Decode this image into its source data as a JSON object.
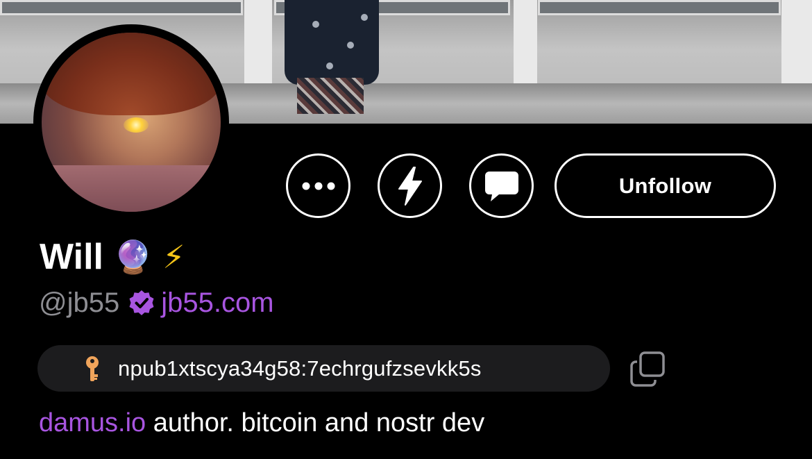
{
  "profile": {
    "display_name": "Will",
    "name_emojis": [
      "🔮",
      "⚡"
    ],
    "handle": "@jb55",
    "nip05": "jb55.com",
    "npub": "npub1xtscya34g58:7echrgufzsevkk5s",
    "about_link": "damus.io",
    "about_text": " author. bitcoin and nostr dev"
  },
  "actions": {
    "unfollow_label": "Unfollow"
  },
  "icons": {
    "more": "ellipsis-icon",
    "zap": "lightning-icon",
    "dm": "message-bubble-icon",
    "verified": "verified-badge-icon",
    "key": "key-icon",
    "copy": "copy-icon"
  },
  "colors": {
    "background": "#000000",
    "accent": "#a855e0",
    "muted_text": "#8e8e93",
    "pill_background": "#1c1c1e",
    "key_icon": "#f0a45b"
  }
}
